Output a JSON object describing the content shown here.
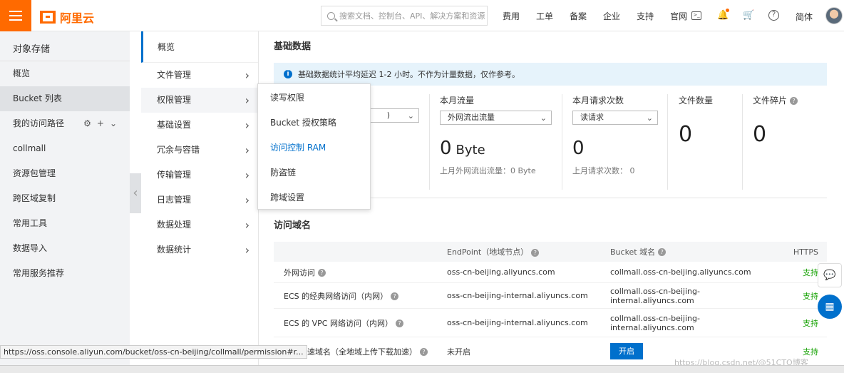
{
  "topbar": {
    "logo_text": "阿里云",
    "search_placeholder": "搜索文档、控制台、API、解决方案和资源",
    "nav_links": [
      "费用",
      "工单",
      "备案",
      "企业",
      "支持",
      "官网"
    ],
    "language": "简体"
  },
  "sidebar": {
    "title": "对象存储",
    "items": [
      {
        "label": "概览"
      },
      {
        "label": "Bucket 列表"
      },
      {
        "label": "我的访问路径"
      },
      {
        "label": "collmall"
      },
      {
        "label": "资源包管理"
      },
      {
        "label": "跨区域复制"
      },
      {
        "label": "常用工具"
      },
      {
        "label": "数据导入"
      },
      {
        "label": "常用服务推荐"
      }
    ]
  },
  "subnav": {
    "items": [
      "概览",
      "文件管理",
      "权限管理",
      "基础设置",
      "冗余与容错",
      "传输管理",
      "日志管理",
      "数据处理",
      "数据统计"
    ]
  },
  "flyout": {
    "items": [
      "读写权限",
      "Bucket 授权策略",
      "访问控制 RAM",
      "防盗链",
      "跨域设置"
    ]
  },
  "main": {
    "basic_title": "基础数据",
    "notice": "基础数据统计平均延迟 1-2 小时。不作为计量数据，仅作参考。",
    "stats": {
      "traffic_label": "本月流量",
      "traffic_select": "外网流出流量",
      "traffic_value": "0",
      "traffic_unit": "Byte",
      "traffic_sub": "上月外网流出流量：0 Byte",
      "requests_label": "本月请求次数",
      "requests_select": "读请求",
      "requests_value": "0",
      "requests_sub": "上月请求次数： 0",
      "files_label": "文件数量",
      "files_value": "0",
      "fragments_label": "文件碎片",
      "fragments_value": "0",
      "storage_select_suffix": ")"
    },
    "domain_title": "访问域名",
    "table": {
      "headers": [
        "",
        "EndPoint（地域节点）",
        "Bucket 域名",
        "HTTPS"
      ],
      "rows": [
        {
          "name": "外网访问",
          "endpoint": "oss-cn-beijing.aliyuncs.com",
          "domain": "collmall.oss-cn-beijing.aliyuncs.com",
          "https": "支持"
        },
        {
          "name": "ECS 的经典网络访问（内网）",
          "endpoint": "oss-cn-beijing-internal.aliyuncs.com",
          "domain": "collmall.oss-cn-beijing-internal.aliyuncs.com",
          "https": "支持"
        },
        {
          "name": "ECS 的 VPC 网络访问（内网）",
          "endpoint": "oss-cn-beijing-internal.aliyuncs.com",
          "domain": "collmall.oss-cn-beijing-internal.aliyuncs.com",
          "https": "支持"
        },
        {
          "name": "传输加速域名（全地域上传下载加速）",
          "endpoint": "未开启",
          "button": "开启",
          "https": "支持"
        }
      ]
    }
  },
  "statusbar": "https://oss.console.aliyun.com/bucket/oss-cn-beijing/collmall/permission#r...",
  "watermark": "https://blog.csdn.net/@51CTO博客",
  "colors": {
    "brand": "#ff6a00",
    "link": "#0070cc",
    "success": "#13a100"
  }
}
